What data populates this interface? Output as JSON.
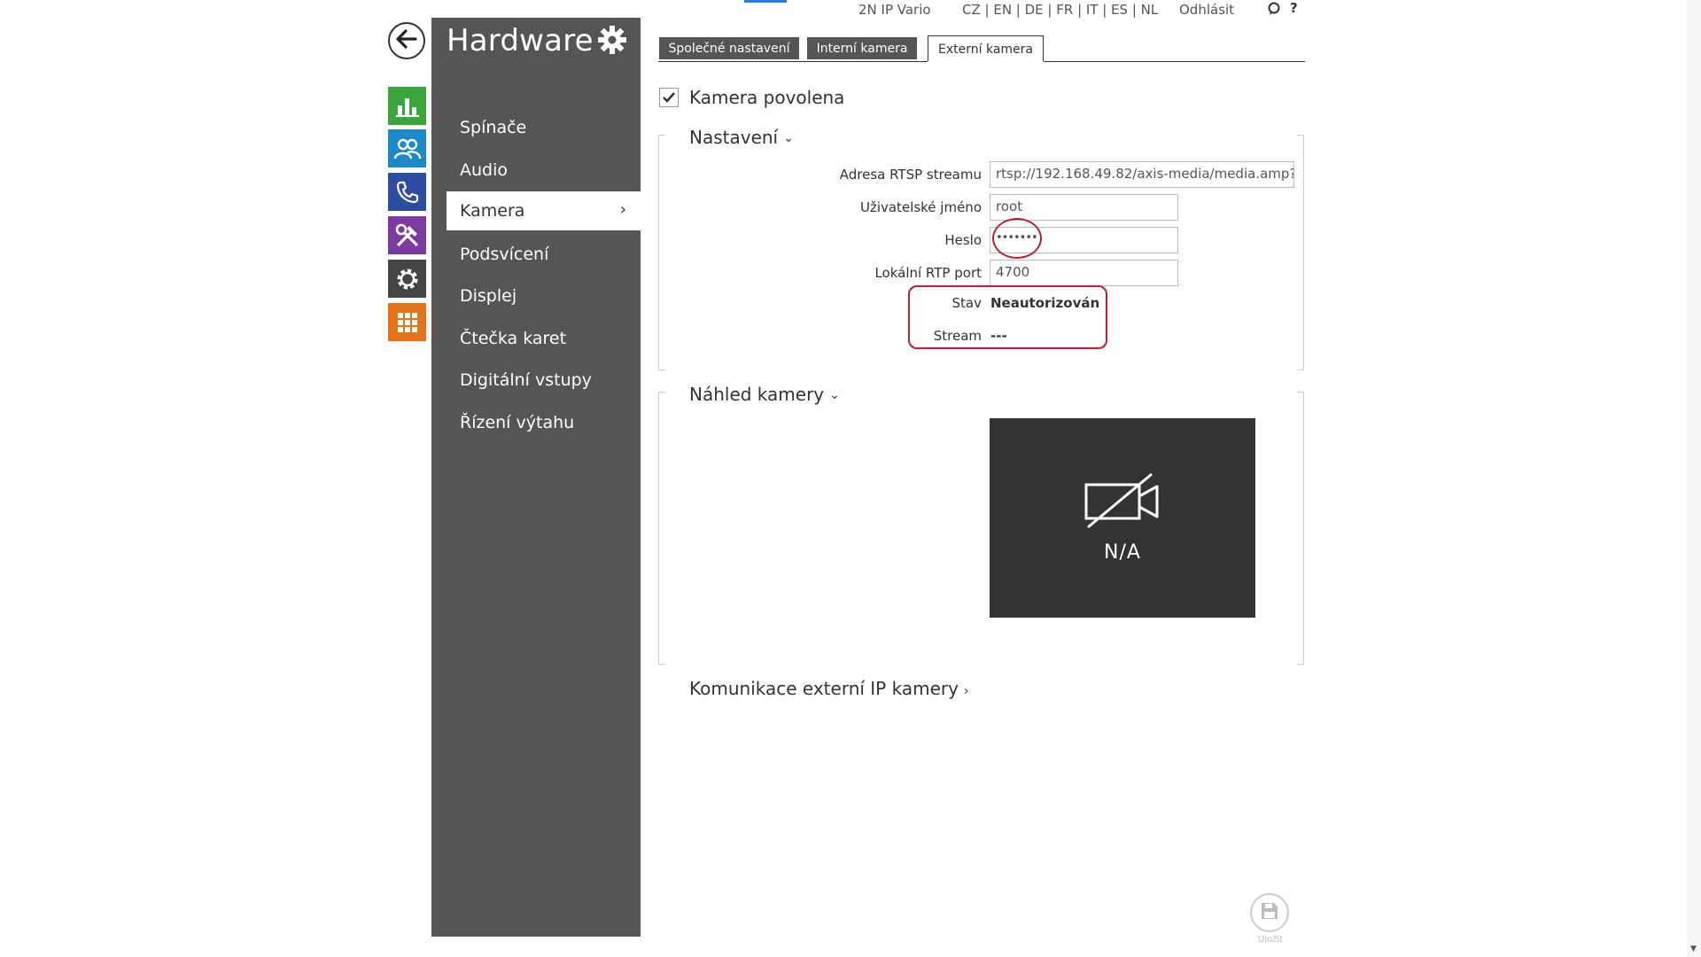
{
  "topbar": {
    "device_name": "2N IP Vario",
    "languages": "CZ | EN | DE | FR | IT | ES | NL",
    "logout": "Odhlásit",
    "help": "?"
  },
  "sidebar": {
    "title": "Hardware",
    "items": [
      {
        "label": "Spínače"
      },
      {
        "label": "Audio"
      },
      {
        "label": "Kamera",
        "active": true
      },
      {
        "label": "Podsvícení"
      },
      {
        "label": "Displej"
      },
      {
        "label": "Čtečka karet"
      },
      {
        "label": "Digitální vstupy"
      },
      {
        "label": "Řízení výtahu"
      }
    ],
    "active_chevron": "›"
  },
  "rail_icons": [
    {
      "icon": "status-chart-icon",
      "color": "#3aa53c"
    },
    {
      "icon": "users-icon",
      "color": "#1e88c9"
    },
    {
      "icon": "phone-icon",
      "color": "#2f4da0"
    },
    {
      "icon": "tools-icon",
      "color": "#7b3aa0"
    },
    {
      "icon": "gear-icon",
      "color": "#444444"
    },
    {
      "icon": "grid-icon",
      "color": "#e4731d"
    }
  ],
  "tabs": [
    {
      "label": "Společné nastavení",
      "active": false
    },
    {
      "label": "Interní kamera",
      "active": false
    },
    {
      "label": "Externí kamera",
      "active": true
    }
  ],
  "camera_enabled": {
    "label": "Kamera povolena",
    "checked": true
  },
  "settings": {
    "title": "Nastavení",
    "rtsp": {
      "label": "Adresa RTSP streamu",
      "value": "rtsp://192.168.49.82/axis-media/media.amp?"
    },
    "username": {
      "label": "Uživatelské jméno",
      "value": "root"
    },
    "password": {
      "label": "Heslo",
      "value": "•••••••"
    },
    "rtp_port": {
      "label": "Lokální RTP port",
      "value": "4700"
    },
    "status": {
      "label": "Stav",
      "value": "Neautorizován"
    },
    "stream": {
      "label": "Stream",
      "value": "---"
    }
  },
  "preview": {
    "title": "Náhled kamery",
    "na_text": "N/A"
  },
  "communication": {
    "title": "Komunikace externí IP kamery"
  },
  "save": {
    "label": "Uložit"
  },
  "colors": {
    "sidebar_bg": "#555555",
    "highlight": "#b5213a",
    "preview_bg": "#333333"
  }
}
